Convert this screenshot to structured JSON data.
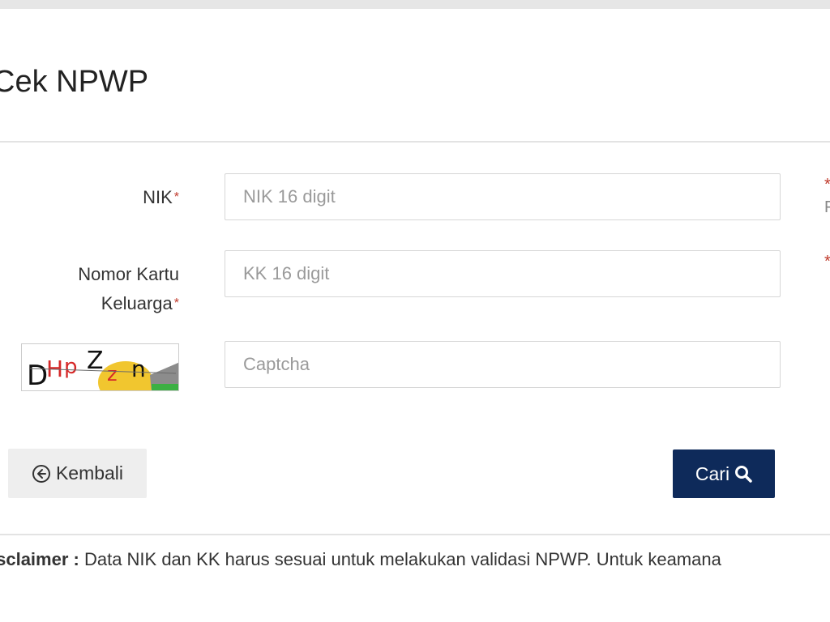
{
  "page": {
    "title": "Cek NPWP"
  },
  "form": {
    "nik": {
      "label": "NIK",
      "required_mark": "*",
      "placeholder": "NIK 16 digit",
      "value": ""
    },
    "kk": {
      "label_line1": "Nomor Kartu",
      "label_line2": "Keluarga",
      "required_mark": "*",
      "placeholder": "KK 16 digit",
      "value": ""
    },
    "captcha": {
      "image_text": "DHpZzn",
      "placeholder": "Captcha",
      "value": ""
    },
    "side_notes": {
      "note1_mark": "*",
      "note1_partial": "F",
      "note2_mark": "*"
    }
  },
  "actions": {
    "back_label": "Kembali",
    "back_icon": "arrow-left-circle-icon",
    "search_label": "Cari",
    "search_icon": "search-icon"
  },
  "footer": {
    "disclaimer_label": "isclaimer :",
    "disclaimer_text": " Data NIK dan KK harus sesuai untuk melakukan validasi NPWP. Untuk keamana"
  },
  "colors": {
    "primary": "#0e2a5a",
    "required": "#c0392b",
    "secondary_button": "#eeeeee"
  }
}
